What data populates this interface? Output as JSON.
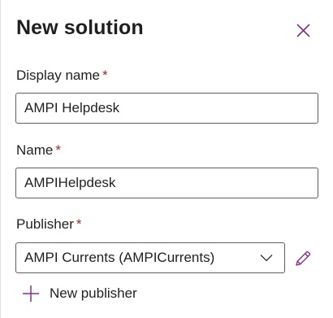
{
  "panel": {
    "title": "New solution",
    "close_icon": "close-icon"
  },
  "form": {
    "display_name": {
      "label": "Display name",
      "required_marker": "*",
      "value": "AMPI Helpdesk"
    },
    "name": {
      "label": "Name",
      "required_marker": "*",
      "value": "AMPIHelpdesk"
    },
    "publisher": {
      "label": "Publisher",
      "required_marker": "*",
      "selected": "AMPI Currents (AMPICurrents)",
      "dropdown_icon": "chevron-down-icon",
      "edit_icon": "pencil-icon"
    },
    "new_publisher": {
      "label": "New publisher",
      "icon": "plus-icon"
    }
  },
  "colors": {
    "accent": "#8a2d8f",
    "required": "#a4262c",
    "border": "#605e5c",
    "text": "#201f1e"
  }
}
